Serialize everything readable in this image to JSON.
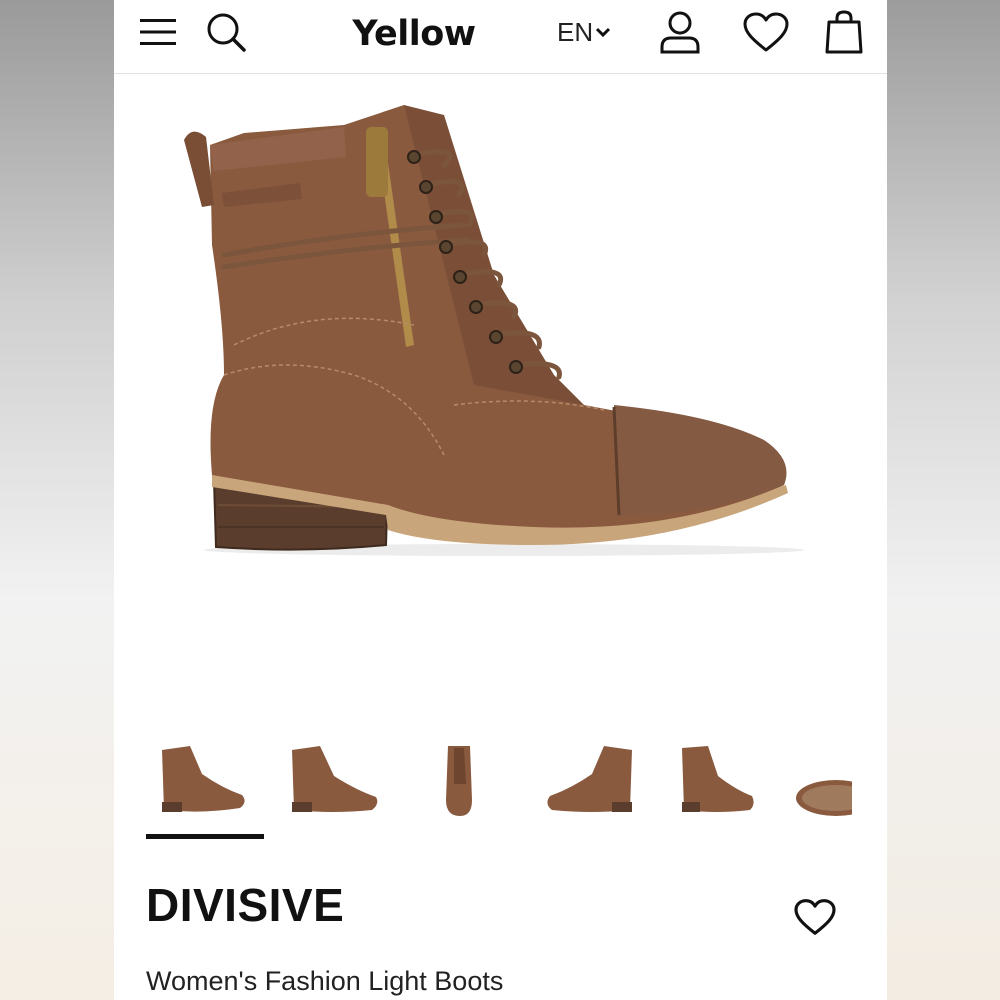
{
  "header": {
    "logo": "Yellow",
    "language": "EN",
    "icons": [
      "menu-icon",
      "search-icon",
      "chevron-down-icon",
      "account-icon",
      "heart-icon",
      "shopping-bag-icon"
    ]
  },
  "product": {
    "brand": "DIVISIVE",
    "name": "Women's Fashion Light Boots",
    "image_alt": "brown-lace-up-ankle-boot",
    "thumbnail_count": 6,
    "selected_thumbnail": 1
  },
  "colors": {
    "leather": "#8a5a3f",
    "leather_dark": "#6e4630",
    "heel": "#5a3d2c",
    "sole": "#c6a37a",
    "text": "#111111"
  }
}
